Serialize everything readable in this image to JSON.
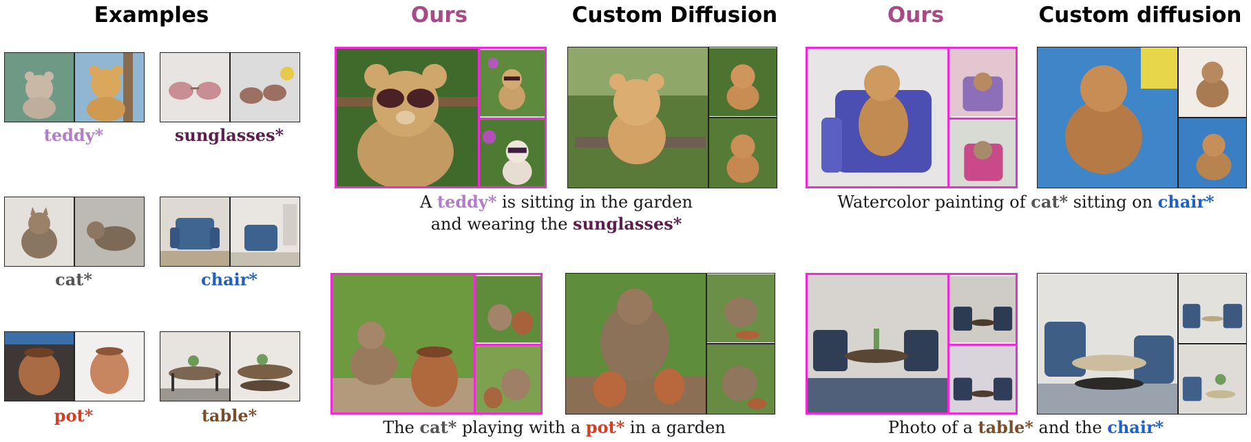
{
  "headers": {
    "examples": "Examples",
    "ours_left": "Ours",
    "custom_left": "Custom Diffusion",
    "ours_right": "Ours",
    "custom_right": "Custom diffusion"
  },
  "labels": {
    "teddy": "teddy*",
    "sunglasses": "sunglasses*",
    "cat": "cat*",
    "chair": "chair*",
    "pot": "pot*",
    "table": "table*"
  },
  "captions": {
    "c1": {
      "p1": "A ",
      "t1": "teddy*",
      "p2": " is sitting in the garden",
      "p3": "and wearing the ",
      "t2": "sunglasses*"
    },
    "c2": {
      "p1": "Watercolor painting of ",
      "t1": "cat*",
      "p2": " sitting on ",
      "t2": "chair*"
    },
    "c3": {
      "p1": "The ",
      "t1": "cat*",
      "p2": " playing with a ",
      "t2": "pot*",
      "p3": " in a garden"
    },
    "c4": {
      "p1": "Photo of a ",
      "t1": "table*",
      "p2": " and the ",
      "t2": "chair*"
    }
  },
  "colors": {
    "ours_header": "#a84a8a",
    "highlight_frame": "#ee2bd6",
    "teddy": "#b37cc9",
    "sunglasses": "#5c1d4f",
    "cat": "#555555",
    "chair": "#1e5fc8",
    "pot": "#d13f26",
    "table": "#7a4e2a"
  }
}
